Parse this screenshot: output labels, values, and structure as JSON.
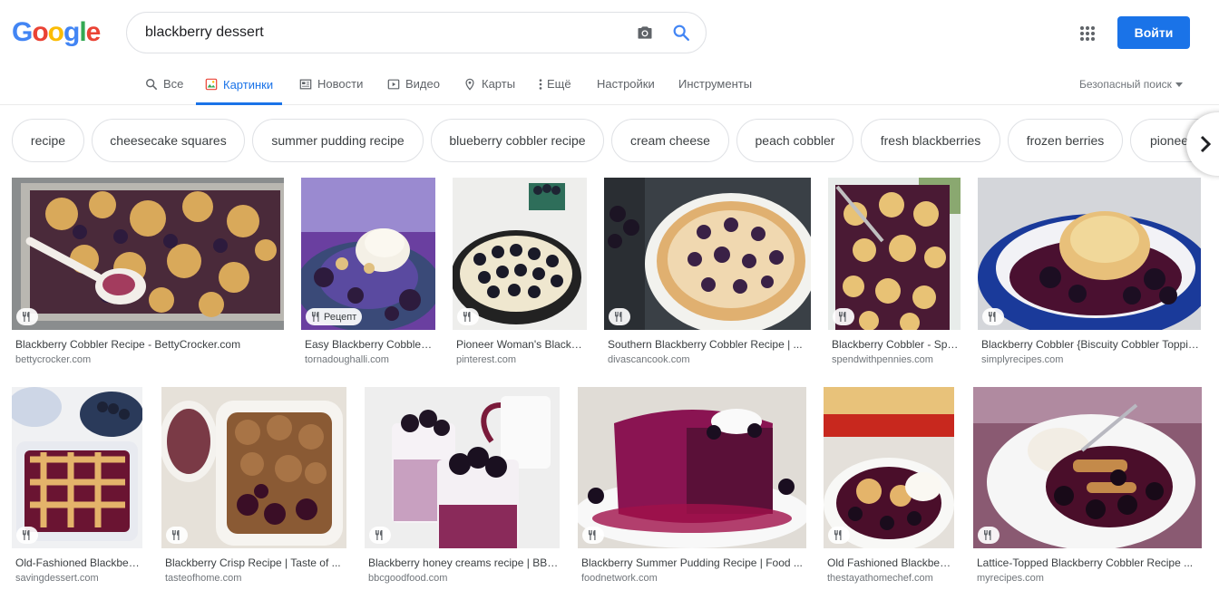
{
  "logo": "Google",
  "search": {
    "query": "blackberry dessert"
  },
  "header": {
    "signin_label": "Войти"
  },
  "tabs": [
    {
      "label": "Все"
    },
    {
      "label": "Картинки"
    },
    {
      "label": "Новости"
    },
    {
      "label": "Видео"
    },
    {
      "label": "Карты"
    },
    {
      "label": "Ещё"
    },
    {
      "label": "Настройки"
    },
    {
      "label": "Инструменты"
    }
  ],
  "safe_search": "Безопасный поиск",
  "chips": [
    "recipe",
    "cheesecake squares",
    "summer pudding recipe",
    "blueberry cobbler recipe",
    "cream cheese",
    "peach cobbler",
    "fresh blackberries",
    "frozen berries",
    "pioneer"
  ],
  "recipe_badge": "Рецепт",
  "results": [
    {
      "title": "Blackberry Cobbler Recipe - BettyCrocker.com",
      "site": "bettycrocker.com"
    },
    {
      "title": "Easy Blackberry Cobbler ...",
      "site": "tornadoughalli.com"
    },
    {
      "title": "Pioneer Woman's Blackberry ...",
      "site": "pinterest.com"
    },
    {
      "title": "Southern Blackberry Cobbler Recipe | ...",
      "site": "divascancook.com"
    },
    {
      "title": "Blackberry Cobbler - Spend ...",
      "site": "spendwithpennies.com"
    },
    {
      "title": "Blackberry Cobbler {Biscuity Cobbler Topping} ...",
      "site": "simplyrecipes.com"
    },
    {
      "title": "Old-Fashioned Blackberry ...",
      "site": "savingdessert.com"
    },
    {
      "title": "Blackberry Crisp Recipe | Taste of ...",
      "site": "tasteofhome.com"
    },
    {
      "title": "Blackberry honey creams recipe | BBC ...",
      "site": "bbcgoodfood.com"
    },
    {
      "title": "Blackberry Summer Pudding Recipe | Food ...",
      "site": "foodnetwork.com"
    },
    {
      "title": "Old Fashioned Blackberry ...",
      "site": "thestayathomechef.com"
    },
    {
      "title": "Lattice-Topped Blackberry Cobbler Recipe ...",
      "site": "myrecipes.com"
    }
  ],
  "colors": {
    "accent": "#1a73e8",
    "berry": "#2d1b3d",
    "crust": "#d9a95a",
    "juice": "#7a1e4a"
  },
  "icons": [
    "camera-icon",
    "search-icon",
    "apps-icon",
    "fork-knife-icon",
    "chevron-right-icon"
  ]
}
